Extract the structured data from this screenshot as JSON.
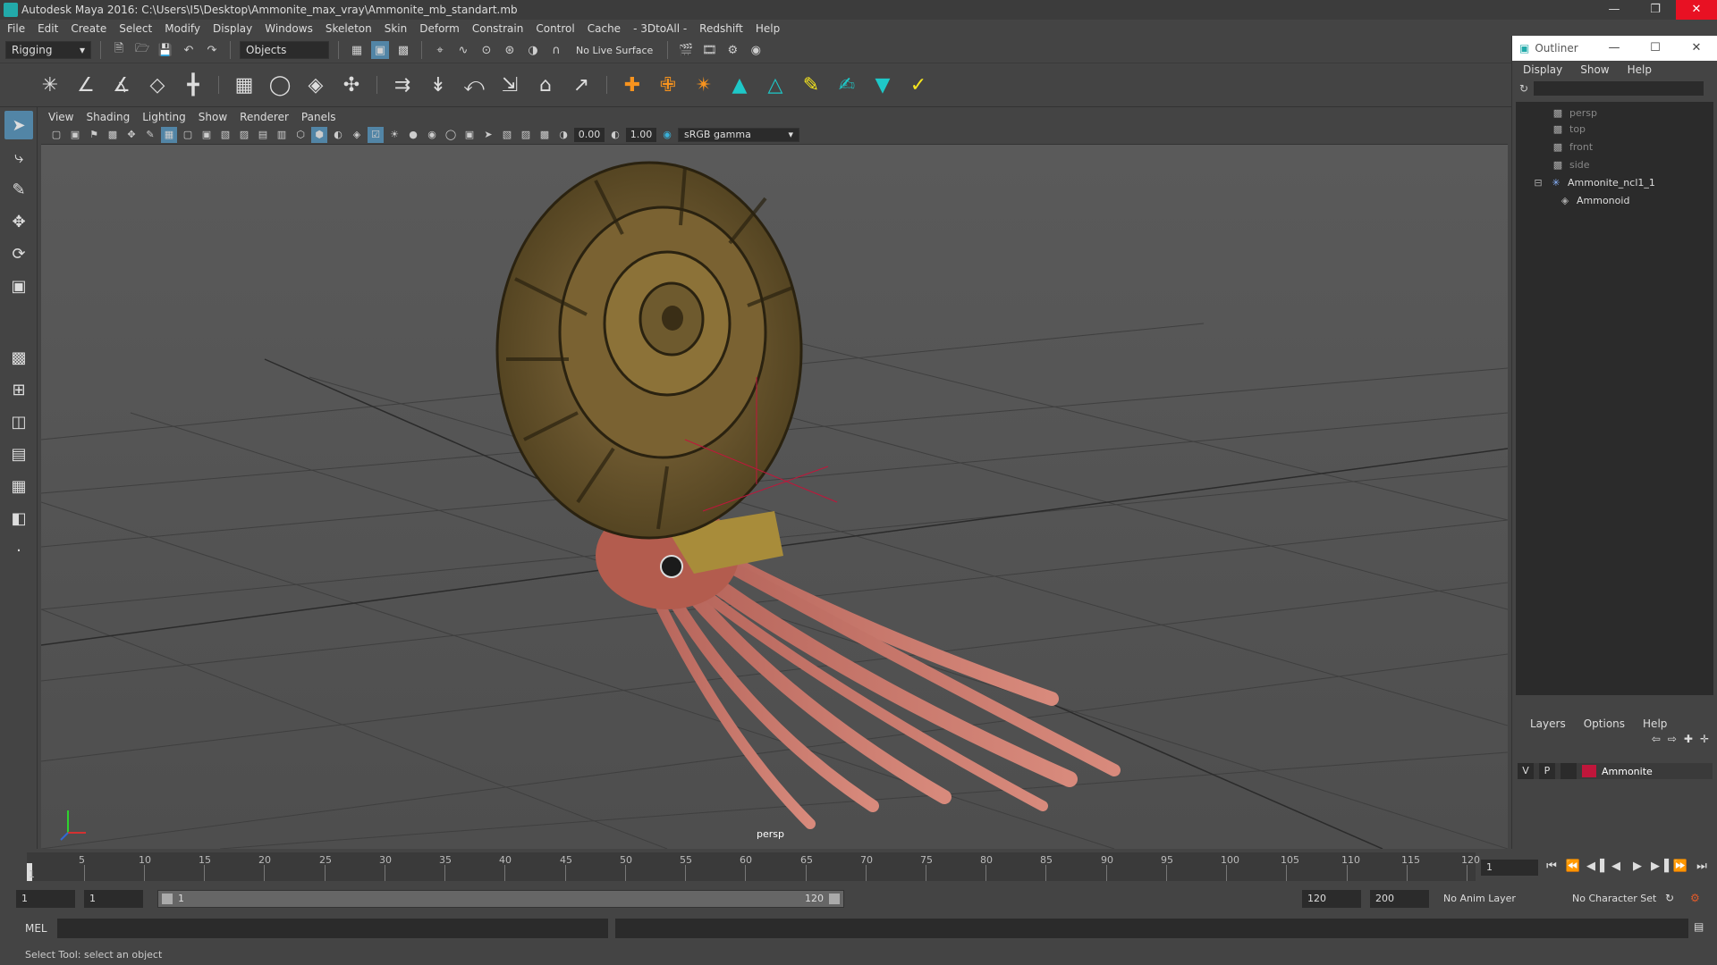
{
  "window": {
    "title": "Autodesk Maya 2016: C:\\Users\\I5\\Desktop\\Ammonite_max_vray\\Ammonite_mb_standart.mb"
  },
  "menu": [
    "File",
    "Edit",
    "Create",
    "Select",
    "Modify",
    "Display",
    "Windows",
    "Skeleton",
    "Skin",
    "Deform",
    "Constrain",
    "Control",
    "Cache",
    "- 3DtoAll -",
    "Redshift",
    "Help"
  ],
  "status": {
    "menuset": "Rigging",
    "selection_mode": "Objects",
    "live_surface": "No Live Surface"
  },
  "panel_menu": [
    "View",
    "Shading",
    "Lighting",
    "Show",
    "Renderer",
    "Panels"
  ],
  "panel_toolbar": {
    "exposure": "0.00",
    "gamma": "1.00",
    "colorspace": "sRGB gamma"
  },
  "viewport": {
    "camera": "persp"
  },
  "outliner": {
    "title": "Outliner",
    "menu": [
      "Display",
      "Show",
      "Help"
    ],
    "nodes": [
      {
        "label": "persp",
        "main": false
      },
      {
        "label": "top",
        "main": false
      },
      {
        "label": "front",
        "main": false
      },
      {
        "label": "side",
        "main": false
      },
      {
        "label": "Ammonite_ncl1_1",
        "main": true
      },
      {
        "label": "Ammonoid",
        "main": true
      }
    ]
  },
  "layers": {
    "menu": [
      "Layers",
      "Options",
      "Help"
    ],
    "row": {
      "v": "V",
      "p": "P",
      "name": "Ammonite",
      "color": "#c0163b"
    }
  },
  "timeline": {
    "ticks": [
      "5",
      "10",
      "15",
      "20",
      "25",
      "30",
      "35",
      "40",
      "45",
      "50",
      "55",
      "60",
      "65",
      "70",
      "75",
      "80",
      "85",
      "90",
      "95",
      "100",
      "105",
      "110",
      "115",
      "120"
    ],
    "start": "1",
    "current": "1"
  },
  "range": {
    "start": "1",
    "inner_start": "1",
    "slider_start": "1",
    "slider_end": "120",
    "end": "120",
    "anim_end": "200",
    "anim_layer": "No Anim Layer",
    "character_set": "No Character Set"
  },
  "cmd": {
    "mode": "MEL"
  },
  "help_line": "Select Tool: select an object"
}
